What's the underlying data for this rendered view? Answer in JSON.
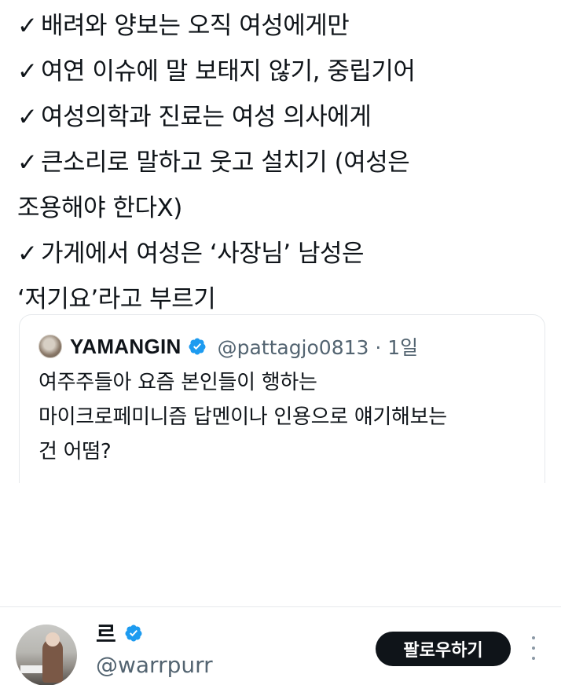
{
  "tweet": {
    "check_mark": "✓",
    "lines": [
      "배려와 양보는 오직 여성에게만",
      "여연 이슈에 말 보태지 않기, 중립기어",
      "여성의학과 진료는 여성 의사에게",
      "큰소리로 말하고 웃고 설치기 (여성은",
      "조용해야 한다X)",
      "가게에서 여성은 ‘사장님’ 남성은",
      "‘저기요’라고 부르기"
    ]
  },
  "quote": {
    "name": "YAMANGIN",
    "handle": "@pattagjo0813 · 1일",
    "text_lines": [
      "여주주들아 요즘 본인들이 행하는",
      "마이크로페미니즘 답멘이나 인용으로 얘기해보는",
      "건 어떰?"
    ]
  },
  "author": {
    "name": "르",
    "handle": "@warrpurr",
    "follow_label": "팔로우하기"
  },
  "colors": {
    "text": "#0f1419",
    "secondary": "#536471",
    "verified": "#1d9bf0",
    "button_bg": "#0f1419",
    "border": "#e6e9ec"
  },
  "icons": [
    "verified-badge-icon",
    "more-icon"
  ]
}
